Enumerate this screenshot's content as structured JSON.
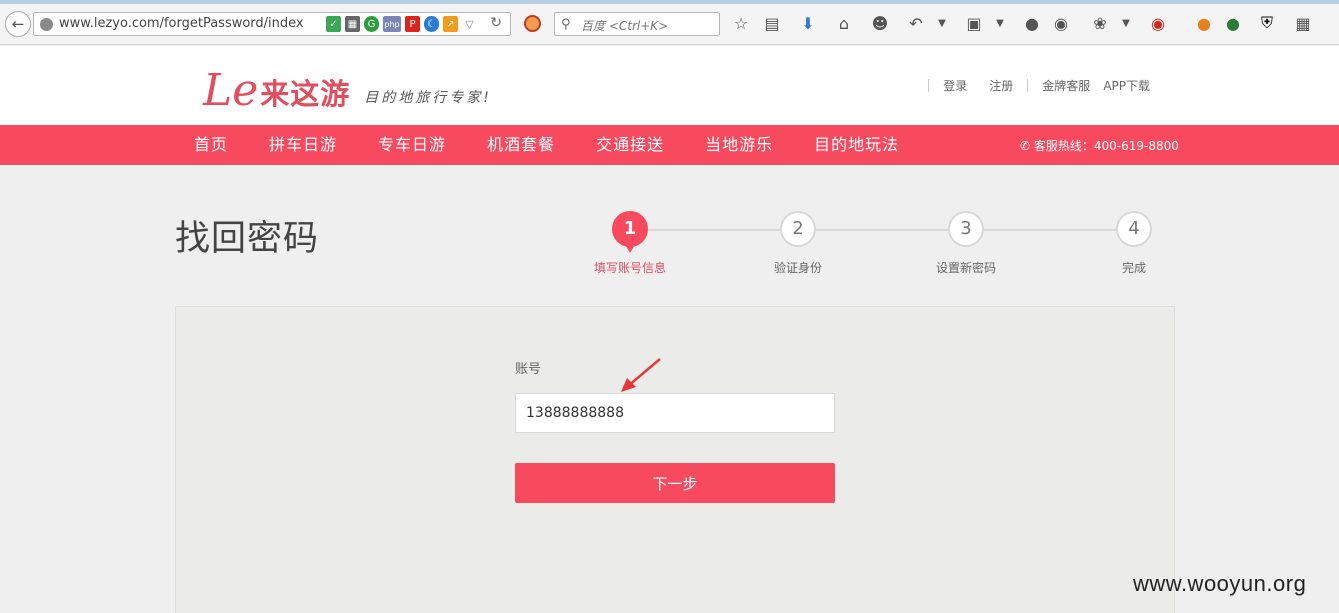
{
  "browser": {
    "url": "www.lezyo.com/forgetPassword/index",
    "search_placeholder": "百度 <Ctrl+K>",
    "url_badges": [
      "G",
      "php",
      "P"
    ]
  },
  "header": {
    "logo_mark": "Le",
    "logo_name": "来这游",
    "slogan": "目的地旅行专家!",
    "links": {
      "login": "登录",
      "register": "注册",
      "support": "金牌客服",
      "app": "APP下载"
    }
  },
  "nav": {
    "items": [
      "首页",
      "拼车日游",
      "专车日游",
      "机酒套餐",
      "交通接送",
      "当地游乐",
      "目的地玩法"
    ],
    "hotline": "客服热线：400-619-8800"
  },
  "page": {
    "title": "找回密码",
    "steps": [
      {
        "num": "1",
        "label": "填写账号信息",
        "active": true
      },
      {
        "num": "2",
        "label": "验证身份",
        "active": false
      },
      {
        "num": "3",
        "label": "设置新密码",
        "active": false
      },
      {
        "num": "4",
        "label": "完成",
        "active": false
      }
    ]
  },
  "form": {
    "account_label": "账号",
    "account_value": "13888888888",
    "next_label": "下一步"
  },
  "watermark": "www.wooyun.org",
  "colors": {
    "brand": "#f74a5f",
    "brand_text": "#e24e5e"
  }
}
